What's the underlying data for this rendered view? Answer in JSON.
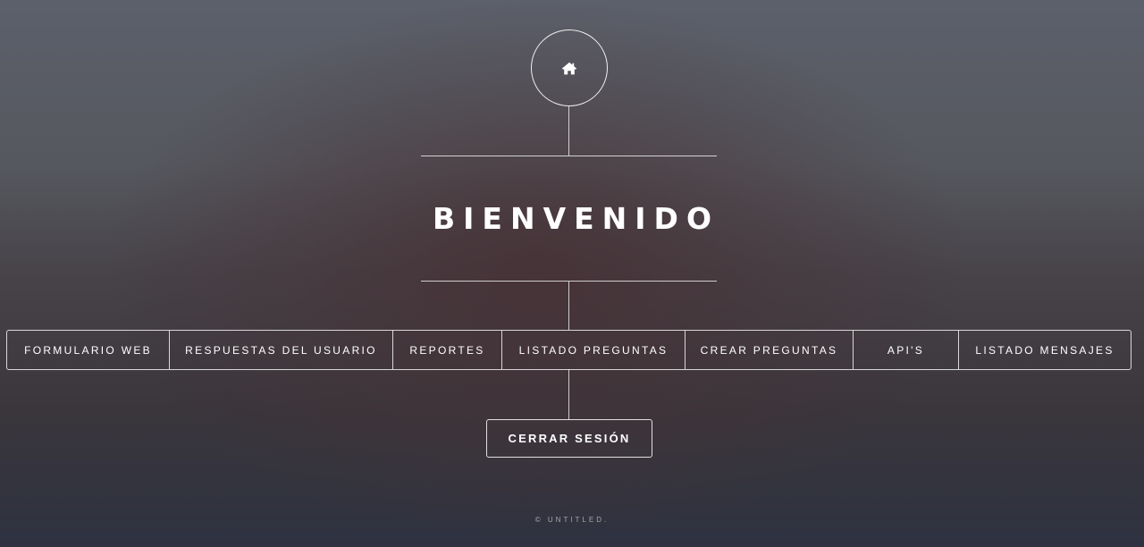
{
  "header": {
    "logo_icon": "home-icon",
    "title": "BIENVENIDO"
  },
  "nav": {
    "items": [
      {
        "label": "FORMULARIO WEB"
      },
      {
        "label": "RESPUESTAS DEL USUARIO"
      },
      {
        "label": "REPORTES"
      },
      {
        "label": "LISTADO PREGUNTAS"
      },
      {
        "label": "CREAR PREGUNTAS"
      },
      {
        "label": "API'S"
      },
      {
        "label": "LISTADO MENSAJES"
      }
    ]
  },
  "actions": {
    "logout_label": "CERRAR SESIÓN"
  },
  "footer": {
    "copyright": "© UNTITLED."
  }
}
